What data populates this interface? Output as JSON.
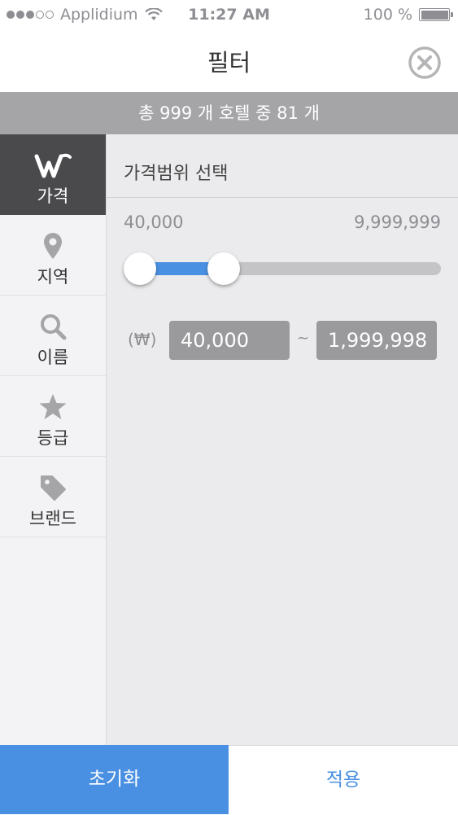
{
  "status": {
    "carrier": "Applidium",
    "time": "11:27 AM",
    "battery": "100 %",
    "signal_dots_filled": 3,
    "signal_dots_total": 5
  },
  "header": {
    "title": "필터",
    "close_icon": "close-circle-icon"
  },
  "summary": {
    "text": "총 999 개 호텔 중 81 개"
  },
  "sidebar": {
    "items": [
      {
        "label": "가격",
        "icon": "w-logo-icon",
        "active": true
      },
      {
        "label": "지역",
        "icon": "location-pin-icon",
        "active": false
      },
      {
        "label": "이름",
        "icon": "search-icon",
        "active": false
      },
      {
        "label": "등급",
        "icon": "star-icon",
        "active": false
      },
      {
        "label": "브랜드",
        "icon": "tag-icon",
        "active": false
      }
    ]
  },
  "price": {
    "section_title": "가격범위 선택",
    "range_min": "40,000",
    "range_max": "9,999,999",
    "currency": "(₩)",
    "selected_min": "40,000",
    "selected_max": "1,999,998",
    "separator": "~",
    "slider_low": 0.0,
    "slider_high": 0.295
  },
  "footer": {
    "reset_label": "초기화",
    "apply_label": "적용"
  },
  "colors": {
    "accent": "#4a90e2",
    "active_tab": "#4a4a4c",
    "summary_bar": "#a5a5a8"
  }
}
